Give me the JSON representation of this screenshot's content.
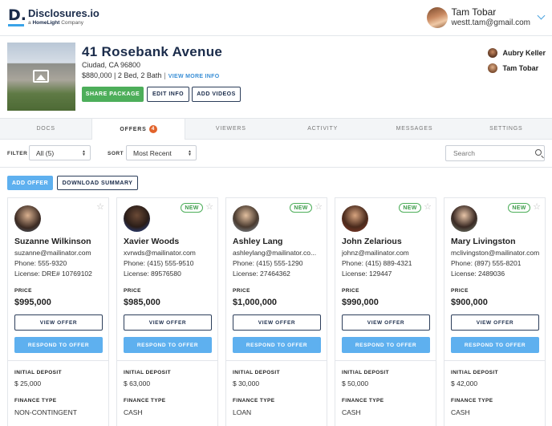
{
  "brand": {
    "logo_mark": "D.",
    "name": "Disclosures.io",
    "sub_prefix": "a",
    "sub_company": "HomeLight",
    "sub_suffix": "Company"
  },
  "user": {
    "name": "Tam Tobar",
    "email": "westt.tam@gmail.com"
  },
  "property": {
    "address": "41 Rosebank Avenue",
    "city": "Ciudad, CA 96800",
    "summary": "$880,000 | 2 Bed, 2 Bath",
    "view_more": "VIEW MORE INFO",
    "share": "SHARE PACKAGE",
    "edit": "EDIT INFO",
    "add_videos": "ADD VIDEOS",
    "agents": [
      "Aubry Keller",
      "Tam Tobar"
    ]
  },
  "tabs": [
    {
      "label": "DOCS"
    },
    {
      "label": "OFFERS",
      "badge": "4"
    },
    {
      "label": "VIEWERS"
    },
    {
      "label": "ACTIVITY"
    },
    {
      "label": "MESSAGES"
    },
    {
      "label": "SETTINGS"
    }
  ],
  "filters": {
    "filter_label": "FILTER",
    "filter_value": "All (5)",
    "sort_label": "SORT",
    "sort_value": "Most Recent",
    "search_placeholder": "Search"
  },
  "actions": {
    "add_offer": "ADD OFFER",
    "download_summary": "DOWNLOAD SUMMARY"
  },
  "labels": {
    "price": "PRICE",
    "view_offer": "VIEW OFFER",
    "respond": "RESPOND TO OFFER",
    "initial_deposit": "INITIAL DEPOSIT",
    "finance_type": "FINANCE TYPE",
    "new": "NEW"
  },
  "offers": [
    {
      "name": "Suzanne Wilkinson",
      "email": "suzanne@mailinator.com",
      "phone": "Phone: 555-9320",
      "license": "License: DRE# 10769102",
      "price": "$995,000",
      "deposit": "$ 25,000",
      "finance": "NON-CONTINGENT",
      "is_new": false
    },
    {
      "name": "Xavier Woods",
      "email": "xvrwds@mailinator.com",
      "phone": "Phone: (415) 555-9510",
      "license": "License: 89576580",
      "price": "$985,000",
      "deposit": "$ 63,000",
      "finance": "CASH",
      "is_new": true
    },
    {
      "name": "Ashley Lang",
      "email": "ashleylang@mailinator.co...",
      "phone": "Phone: (415) 555-1290",
      "license": "License: 27464362",
      "price": "$1,000,000",
      "deposit": "$ 30,000",
      "finance": "LOAN",
      "is_new": true
    },
    {
      "name": "John Zelarious",
      "email": "johnz@mailinator.com",
      "phone": "Phone: (415) 889-4321",
      "license": "License: 129447",
      "price": "$990,000",
      "deposit": "$ 50,000",
      "finance": "CASH",
      "is_new": true
    },
    {
      "name": "Mary Livingston",
      "email": "mclivingston@mailinator.com",
      "phone": "Phone: (897) 555-8201",
      "license": "License: 2489036",
      "price": "$900,000",
      "deposit": "$ 42,000",
      "finance": "CASH",
      "is_new": true
    }
  ],
  "colors": {
    "accent_blue": "#5eb0ef",
    "green": "#4dae5a",
    "navy": "#1a2b4a",
    "badge_orange": "#e2632b"
  }
}
